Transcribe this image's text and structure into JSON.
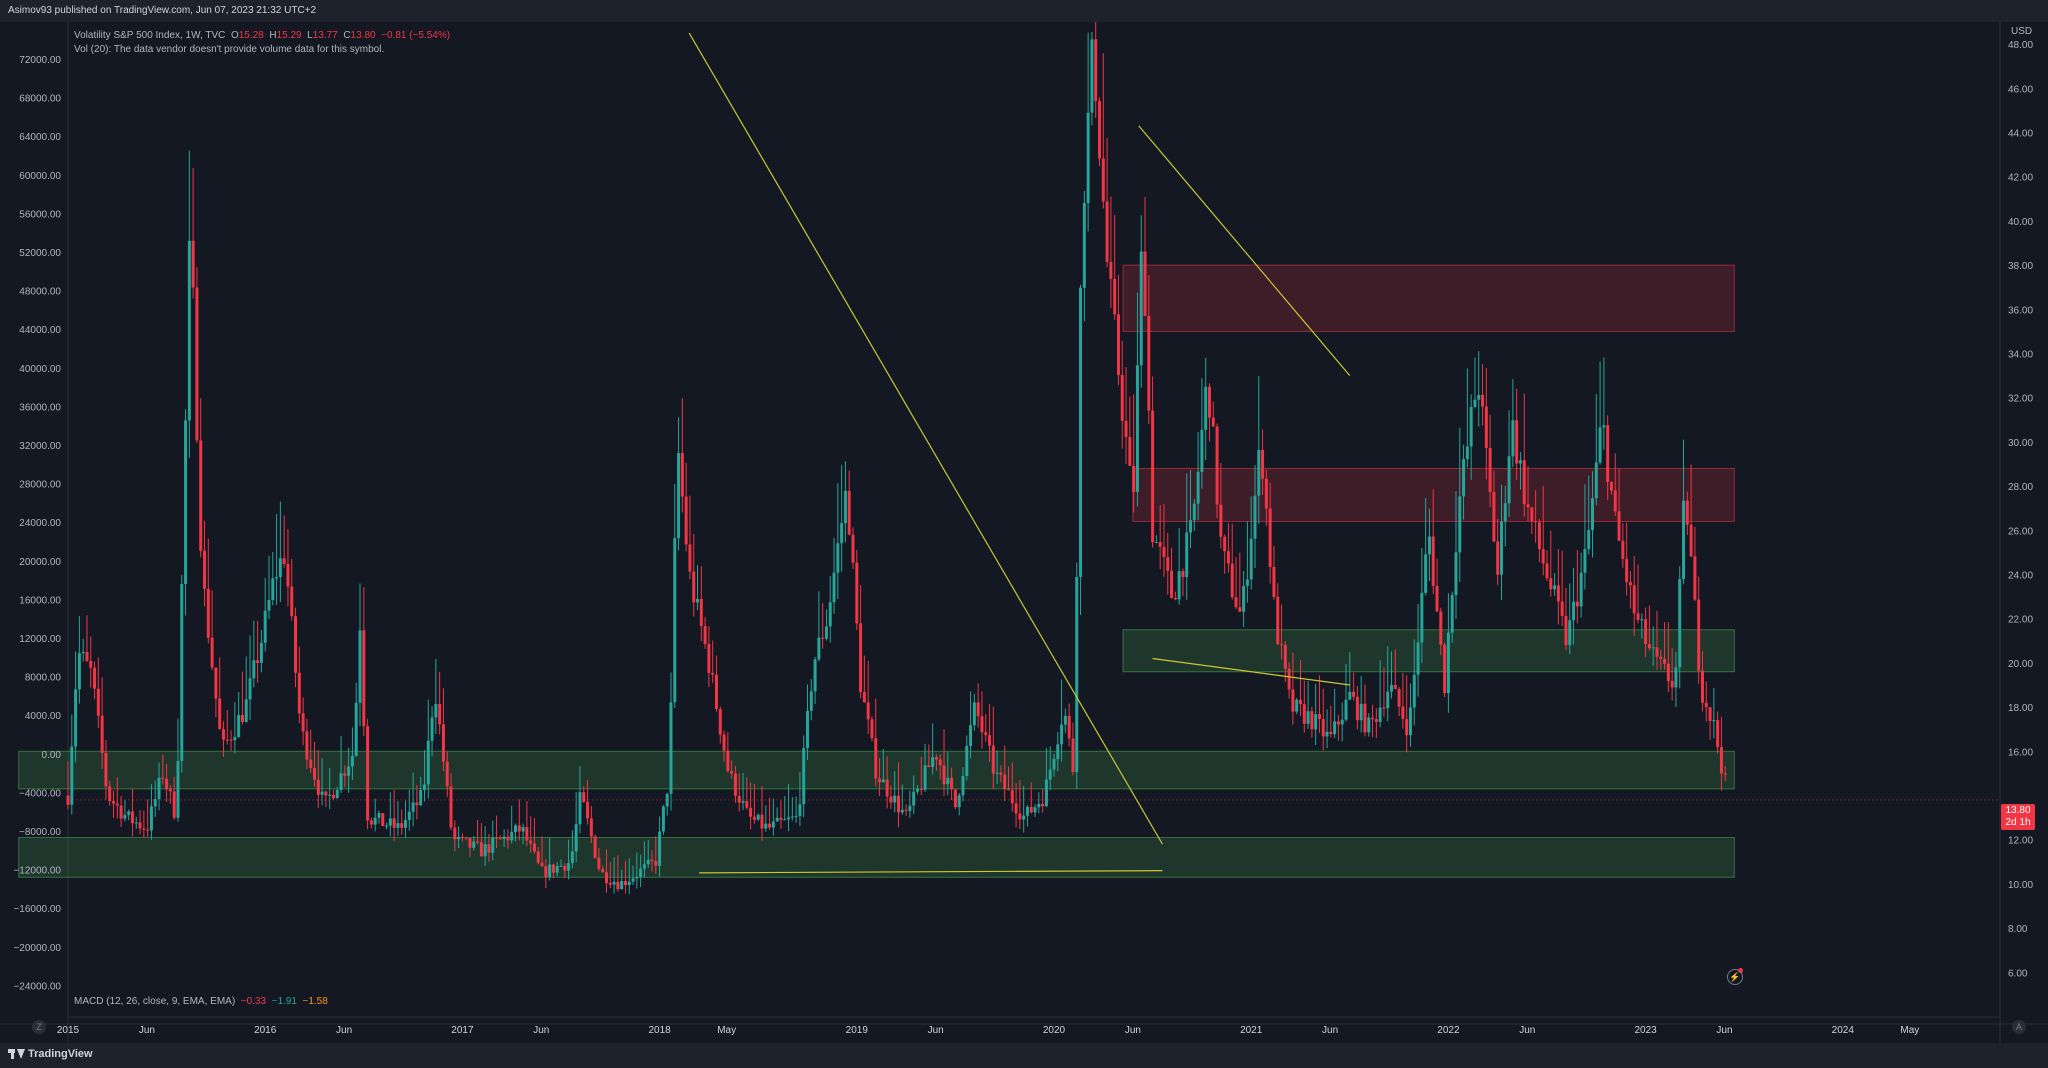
{
  "header": {
    "published_text": "Asimov93 published on TradingView.com, Jun 07, 2023 21:32 UTC+2"
  },
  "legend": {
    "symbol": "Volatility S&P 500 Index, 1W, TVC",
    "o_label": "O",
    "o_value": "15.28",
    "h_label": "H",
    "h_value": "15.29",
    "l_label": "L",
    "l_value": "13.77",
    "c_label": "C",
    "c_value": "13.80",
    "change": "−0.81 (−5.54%)",
    "vol_text": "Vol (20): The data vendor doesn't provide volume data for this symbol."
  },
  "macd": {
    "label": "MACD (12, 26, close, 9, EMA, EMA)",
    "v1": "−0.33",
    "v2": "−1.91",
    "v3": "−1.58"
  },
  "footer": {
    "brand": "TradingView"
  },
  "currency": "USD",
  "last_price": {
    "value": "13.80",
    "countdown": "2d 1h"
  },
  "controls": {
    "left_button": "Z",
    "right_button": "A"
  },
  "colors": {
    "up": "#26a69a",
    "down": "#f23645",
    "supply_zone": "#f23645",
    "demand_zone": "#4caf50",
    "trendline": "#c8c832"
  },
  "chart_data": {
    "type": "candlestick",
    "title": "Volatility S&P 500 Index, 1W, TVC",
    "y_right": {
      "label": "USD",
      "ticks": [
        "48.00",
        "46.00",
        "44.00",
        "42.00",
        "40.00",
        "38.00",
        "36.00",
        "34.00",
        "32.00",
        "30.00",
        "28.00",
        "26.00",
        "24.00",
        "22.00",
        "20.00",
        "18.00",
        "16.00",
        "12.00",
        "10.00",
        "8.00",
        "6.00"
      ],
      "range": [
        5,
        49
      ]
    },
    "y_left": {
      "ticks": [
        "72000.00",
        "68000.00",
        "64000.00",
        "60000.00",
        "56000.00",
        "52000.00",
        "48000.00",
        "44000.00",
        "40000.00",
        "36000.00",
        "32000.00",
        "28000.00",
        "24000.00",
        "20000.00",
        "16000.00",
        "12000.00",
        "8000.00",
        "4000.00",
        "0.00",
        "−4000.00",
        "−8000.00",
        "−12000.00",
        "−16000.00",
        "−20000.00",
        "−24000.00"
      ]
    },
    "x_ticks": [
      {
        "label": "2015",
        "t": 2015.0
      },
      {
        "label": "Jun",
        "t": 2015.4
      },
      {
        "label": "2016",
        "t": 2016.0
      },
      {
        "label": "Jun",
        "t": 2016.4
      },
      {
        "label": "2017",
        "t": 2017.0
      },
      {
        "label": "Jun",
        "t": 2017.4
      },
      {
        "label": "2018",
        "t": 2018.0
      },
      {
        "label": "May",
        "t": 2018.34
      },
      {
        "label": "2019",
        "t": 2019.0
      },
      {
        "label": "Jun",
        "t": 2019.4
      },
      {
        "label": "2020",
        "t": 2020.0
      },
      {
        "label": "Jun",
        "t": 2020.4
      },
      {
        "label": "2021",
        "t": 2021.0
      },
      {
        "label": "Jun",
        "t": 2021.4
      },
      {
        "label": "2022",
        "t": 2022.0
      },
      {
        "label": "Jun",
        "t": 2022.4
      },
      {
        "label": "2023",
        "t": 2023.0
      },
      {
        "label": "Jun",
        "t": 2023.4
      },
      {
        "label": "2024",
        "t": 2024.0
      },
      {
        "label": "May",
        "t": 2024.34
      }
    ],
    "zones": [
      {
        "kind": "supply",
        "t0": 2020.35,
        "t1": 2023.45,
        "low": 35.0,
        "high": 38.0
      },
      {
        "kind": "supply",
        "t0": 2020.4,
        "t1": 2023.45,
        "low": 26.4,
        "high": 28.8
      },
      {
        "kind": "demand",
        "t0": 2020.35,
        "t1": 2023.45,
        "low": 19.6,
        "high": 21.5
      },
      {
        "kind": "demand",
        "t0": 2014.75,
        "t1": 2023.45,
        "low": 14.3,
        "high": 16.0
      },
      {
        "kind": "demand",
        "t0": 2014.75,
        "t1": 2023.45,
        "low": 10.3,
        "high": 12.1
      }
    ],
    "trendlines": [
      {
        "t0": 2018.15,
        "v0": 48.5,
        "t1": 2020.55,
        "v1": 11.8
      },
      {
        "t0": 2020.43,
        "v0": 44.3,
        "t1": 2021.5,
        "v1": 33.0
      },
      {
        "t0": 2020.5,
        "v0": 20.2,
        "t1": 2021.5,
        "v1": 19.0
      },
      {
        "t0": 2018.2,
        "v0": 10.5,
        "t1": 2020.55,
        "v1": 10.6
      }
    ],
    "series_points": [
      [
        2015.0,
        14.0
      ],
      [
        2015.05,
        20.5
      ],
      [
        2015.12,
        19.5
      ],
      [
        2015.2,
        14.0
      ],
      [
        2015.3,
        13.0
      ],
      [
        2015.4,
        12.5
      ],
      [
        2015.48,
        15.0
      ],
      [
        2015.55,
        13.0
      ],
      [
        2015.62,
        40.0
      ],
      [
        2015.68,
        24.0
      ],
      [
        2015.78,
        16.0
      ],
      [
        2015.9,
        18.0
      ],
      [
        2015.98,
        21.0
      ],
      [
        2016.05,
        24.0
      ],
      [
        2016.1,
        25.0
      ],
      [
        2016.18,
        17.0
      ],
      [
        2016.3,
        13.5
      ],
      [
        2016.45,
        16.0
      ],
      [
        2016.48,
        22.0
      ],
      [
        2016.52,
        13.0
      ],
      [
        2016.68,
        12.5
      ],
      [
        2016.8,
        14.0
      ],
      [
        2016.86,
        19.0
      ],
      [
        2016.95,
        12.0
      ],
      [
        2017.1,
        11.5
      ],
      [
        2017.3,
        12.5
      ],
      [
        2017.4,
        10.5
      ],
      [
        2017.55,
        11.0
      ],
      [
        2017.6,
        14.0
      ],
      [
        2017.7,
        10.5
      ],
      [
        2017.8,
        10.0
      ],
      [
        2017.98,
        11.0
      ],
      [
        2018.05,
        15.0
      ],
      [
        2018.09,
        30.0
      ],
      [
        2018.15,
        24.0
      ],
      [
        2018.25,
        20.0
      ],
      [
        2018.35,
        15.0
      ],
      [
        2018.45,
        13.0
      ],
      [
        2018.55,
        12.5
      ],
      [
        2018.7,
        13.0
      ],
      [
        2018.78,
        20.0
      ],
      [
        2018.85,
        22.0
      ],
      [
        2018.95,
        28.0
      ],
      [
        2019.02,
        19.0
      ],
      [
        2019.1,
        15.0
      ],
      [
        2019.25,
        13.0
      ],
      [
        2019.4,
        16.0
      ],
      [
        2019.5,
        13.5
      ],
      [
        2019.6,
        18.0
      ],
      [
        2019.7,
        15.0
      ],
      [
        2019.85,
        13.0
      ],
      [
        2019.95,
        14.0
      ],
      [
        2020.05,
        18.0
      ],
      [
        2020.1,
        15.0
      ],
      [
        2020.14,
        40.0
      ],
      [
        2020.2,
        48.0
      ],
      [
        2020.27,
        38.0
      ],
      [
        2020.33,
        33.0
      ],
      [
        2020.4,
        27.0
      ],
      [
        2020.45,
        40.0
      ],
      [
        2020.5,
        26.0
      ],
      [
        2020.6,
        23.0
      ],
      [
        2020.7,
        26.0
      ],
      [
        2020.78,
        33.0
      ],
      [
        2020.85,
        25.0
      ],
      [
        2020.95,
        22.0
      ],
      [
        2021.05,
        30.0
      ],
      [
        2021.12,
        22.0
      ],
      [
        2021.2,
        18.0
      ],
      [
        2021.3,
        17.5
      ],
      [
        2021.4,
        16.5
      ],
      [
        2021.5,
        18.5
      ],
      [
        2021.6,
        17.0
      ],
      [
        2021.7,
        19.0
      ],
      [
        2021.8,
        17.0
      ],
      [
        2021.9,
        26.0
      ],
      [
        2021.98,
        19.0
      ],
      [
        2022.05,
        27.0
      ],
      [
        2022.15,
        33.0
      ],
      [
        2022.25,
        24.0
      ],
      [
        2022.32,
        31.0
      ],
      [
        2022.4,
        27.0
      ],
      [
        2022.5,
        24.0
      ],
      [
        2022.6,
        21.0
      ],
      [
        2022.7,
        25.0
      ],
      [
        2022.78,
        31.0
      ],
      [
        2022.85,
        26.0
      ],
      [
        2022.95,
        22.0
      ],
      [
        2023.05,
        20.0
      ],
      [
        2023.15,
        19.0
      ],
      [
        2023.2,
        28.0
      ],
      [
        2023.28,
        19.0
      ],
      [
        2023.35,
        17.0
      ],
      [
        2023.42,
        13.8
      ]
    ],
    "current_price": 13.8
  }
}
